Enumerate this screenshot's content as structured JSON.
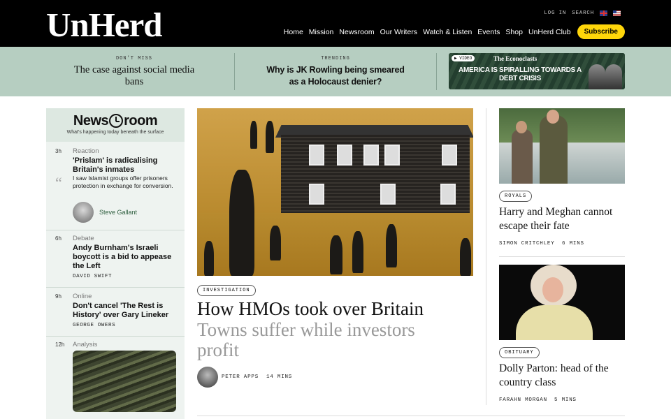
{
  "header": {
    "logo": "UnHerd",
    "login": "LOG IN",
    "search": "SEARCH",
    "nav": [
      "Home",
      "Mission",
      "Newsroom",
      "Our Writers",
      "Watch & Listen",
      "Events",
      "Shop",
      "UnHerd Club"
    ],
    "subscribe": "Subscribe"
  },
  "banner": {
    "dont_miss_label": "DON'T MISS",
    "dont_miss_headline": "The case against social media bans",
    "trending_label": "TRENDING",
    "trending_headline": "Why is JK Rowling being smeared as a Holocaust denier?",
    "video_tag": "VIDEO",
    "video_show": "The Econoclasts",
    "video_title": "America is spiralling towards a debt crisis"
  },
  "sidebar": {
    "title_left": "News",
    "title_right": "room",
    "subtitle": "What's happening today beneath the surface",
    "items": [
      {
        "time": "3h",
        "category": "Reaction",
        "headline": "'Prislam' is radicalising Britain's inmates",
        "quote": "I saw Islamist groups offer prisoners protection in exchange for conversion.",
        "author": "Steve Gallant"
      },
      {
        "time": "6h",
        "category": "Debate",
        "headline": "Andy Burnham's Israeli boycott is a bid to appease the Left",
        "author": "DAVID SWIFT"
      },
      {
        "time": "9h",
        "category": "Online",
        "headline": "Don't cancel 'The Rest is History' over Gary Lineker",
        "author": "GEORGE OWERS"
      },
      {
        "time": "12h",
        "category": "Analysis"
      }
    ]
  },
  "main_story": {
    "tag": "INVESTIGATION",
    "title": "How HMOs took over Britain",
    "subtitle": "Towns suffer while investors profit",
    "author": "PETER APPS",
    "read_time": "14 MINS"
  },
  "right_stories": [
    {
      "tag": "ROYALS",
      "title": "Harry and Meghan cannot escape their fate",
      "author": "SIMON CRITCHLEY",
      "read_time": "6 MINS"
    },
    {
      "tag": "OBITUARY",
      "title": "Dolly Parton: head of the country class",
      "author": "FARAHN MORGAN",
      "read_time": "5 MINS"
    }
  ],
  "colors": {
    "header_bg": "#000000",
    "banner_bg": "#b6cec1",
    "subscribe": "#ffd60a",
    "sidebar_bg": "#eef3f0"
  }
}
